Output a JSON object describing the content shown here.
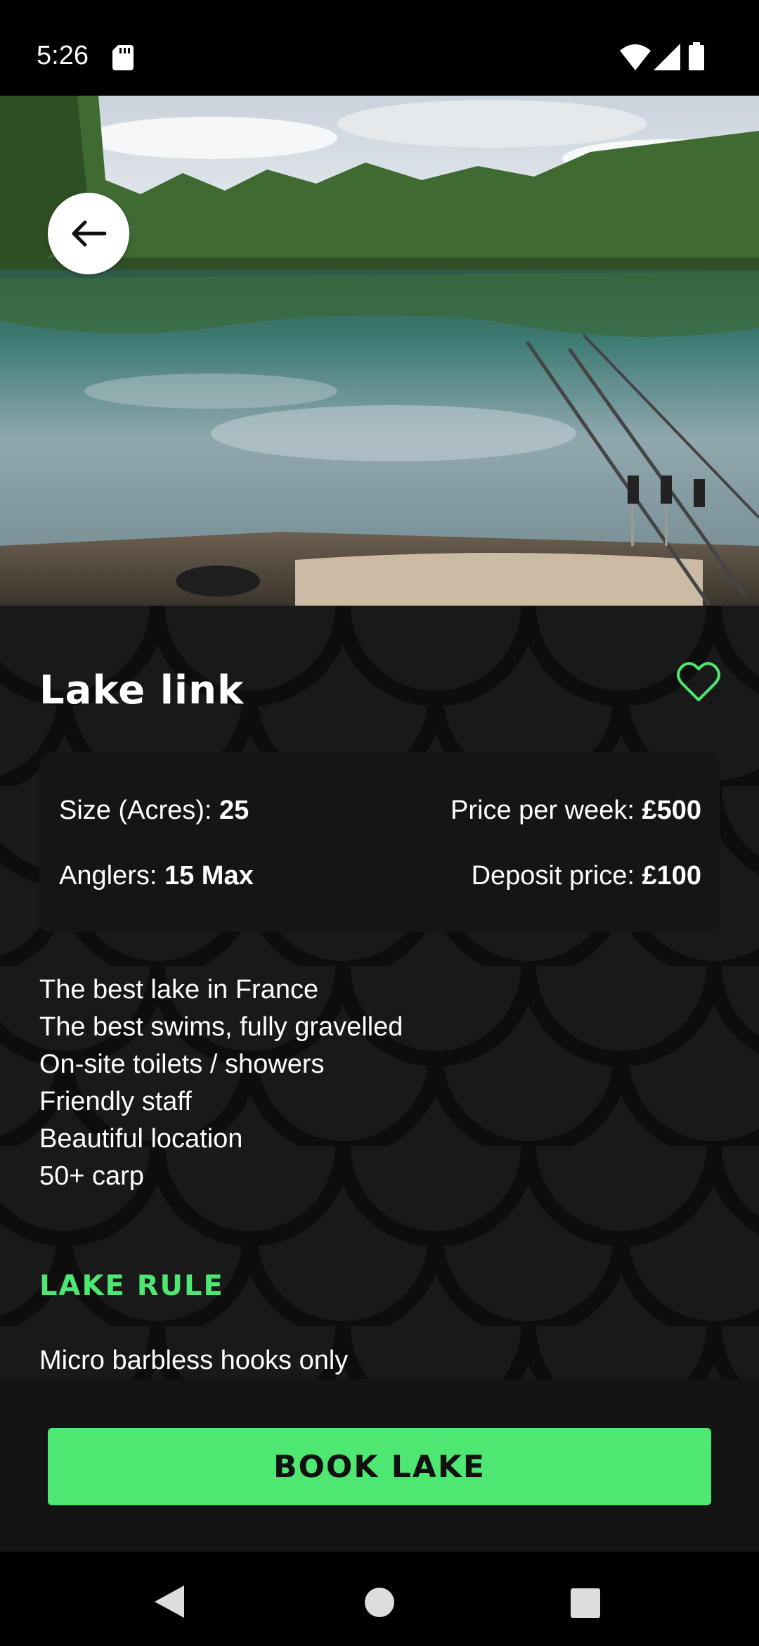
{
  "status_bar": {
    "time": "5:26",
    "icons": [
      "sd-card-icon",
      "wifi-icon",
      "cell-signal-icon",
      "battery-icon"
    ]
  },
  "hero": {
    "image": "lake-with-fishing-rods",
    "back_icon": "arrow-left-icon"
  },
  "lake": {
    "title": "Lake link",
    "favorite_icon": "heart-outline-icon",
    "accent_color": "#4ee772"
  },
  "info": {
    "size_label": "Size (Acres): ",
    "size_value": "25",
    "price_label": "Price per week: ",
    "price_value": "£500",
    "anglers_label": "Anglers: ",
    "anglers_value": "15 Max",
    "deposit_label": "Deposit price: ",
    "deposit_value": "£100"
  },
  "features": [
    "The best lake in France",
    "The best swims,  fully gravelled",
    "On-site toilets / showers",
    "Friendly staff",
    "Beautiful location",
    "50+ carp"
  ],
  "rules": {
    "heading": "LAKE RULE",
    "items": [
      "Micro barbless hooks only"
    ]
  },
  "actions": {
    "book_label": "BOOK LAKE",
    "button_color": "#4ee772"
  },
  "nav_bar": {
    "icons": [
      "nav-back-icon",
      "nav-home-icon",
      "nav-recents-icon"
    ]
  }
}
